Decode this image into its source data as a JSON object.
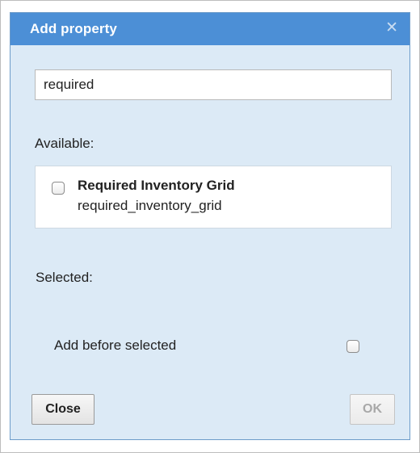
{
  "dialog": {
    "title": "Add property",
    "close_icon": "close-icon",
    "search_value": "required",
    "available_label": "Available:",
    "available_items": [
      {
        "title": "Required Inventory Grid",
        "name": "required_inventory_grid",
        "checked": false
      }
    ],
    "selected_label": "Selected:",
    "add_before_label": "Add before selected",
    "add_before_checked": false,
    "close_button": "Close",
    "ok_button": "OK"
  },
  "colors": {
    "titlebar": "#4c8fd6",
    "dialog_bg": "#dceaf6",
    "disabled_text": "#a8a8a8"
  }
}
